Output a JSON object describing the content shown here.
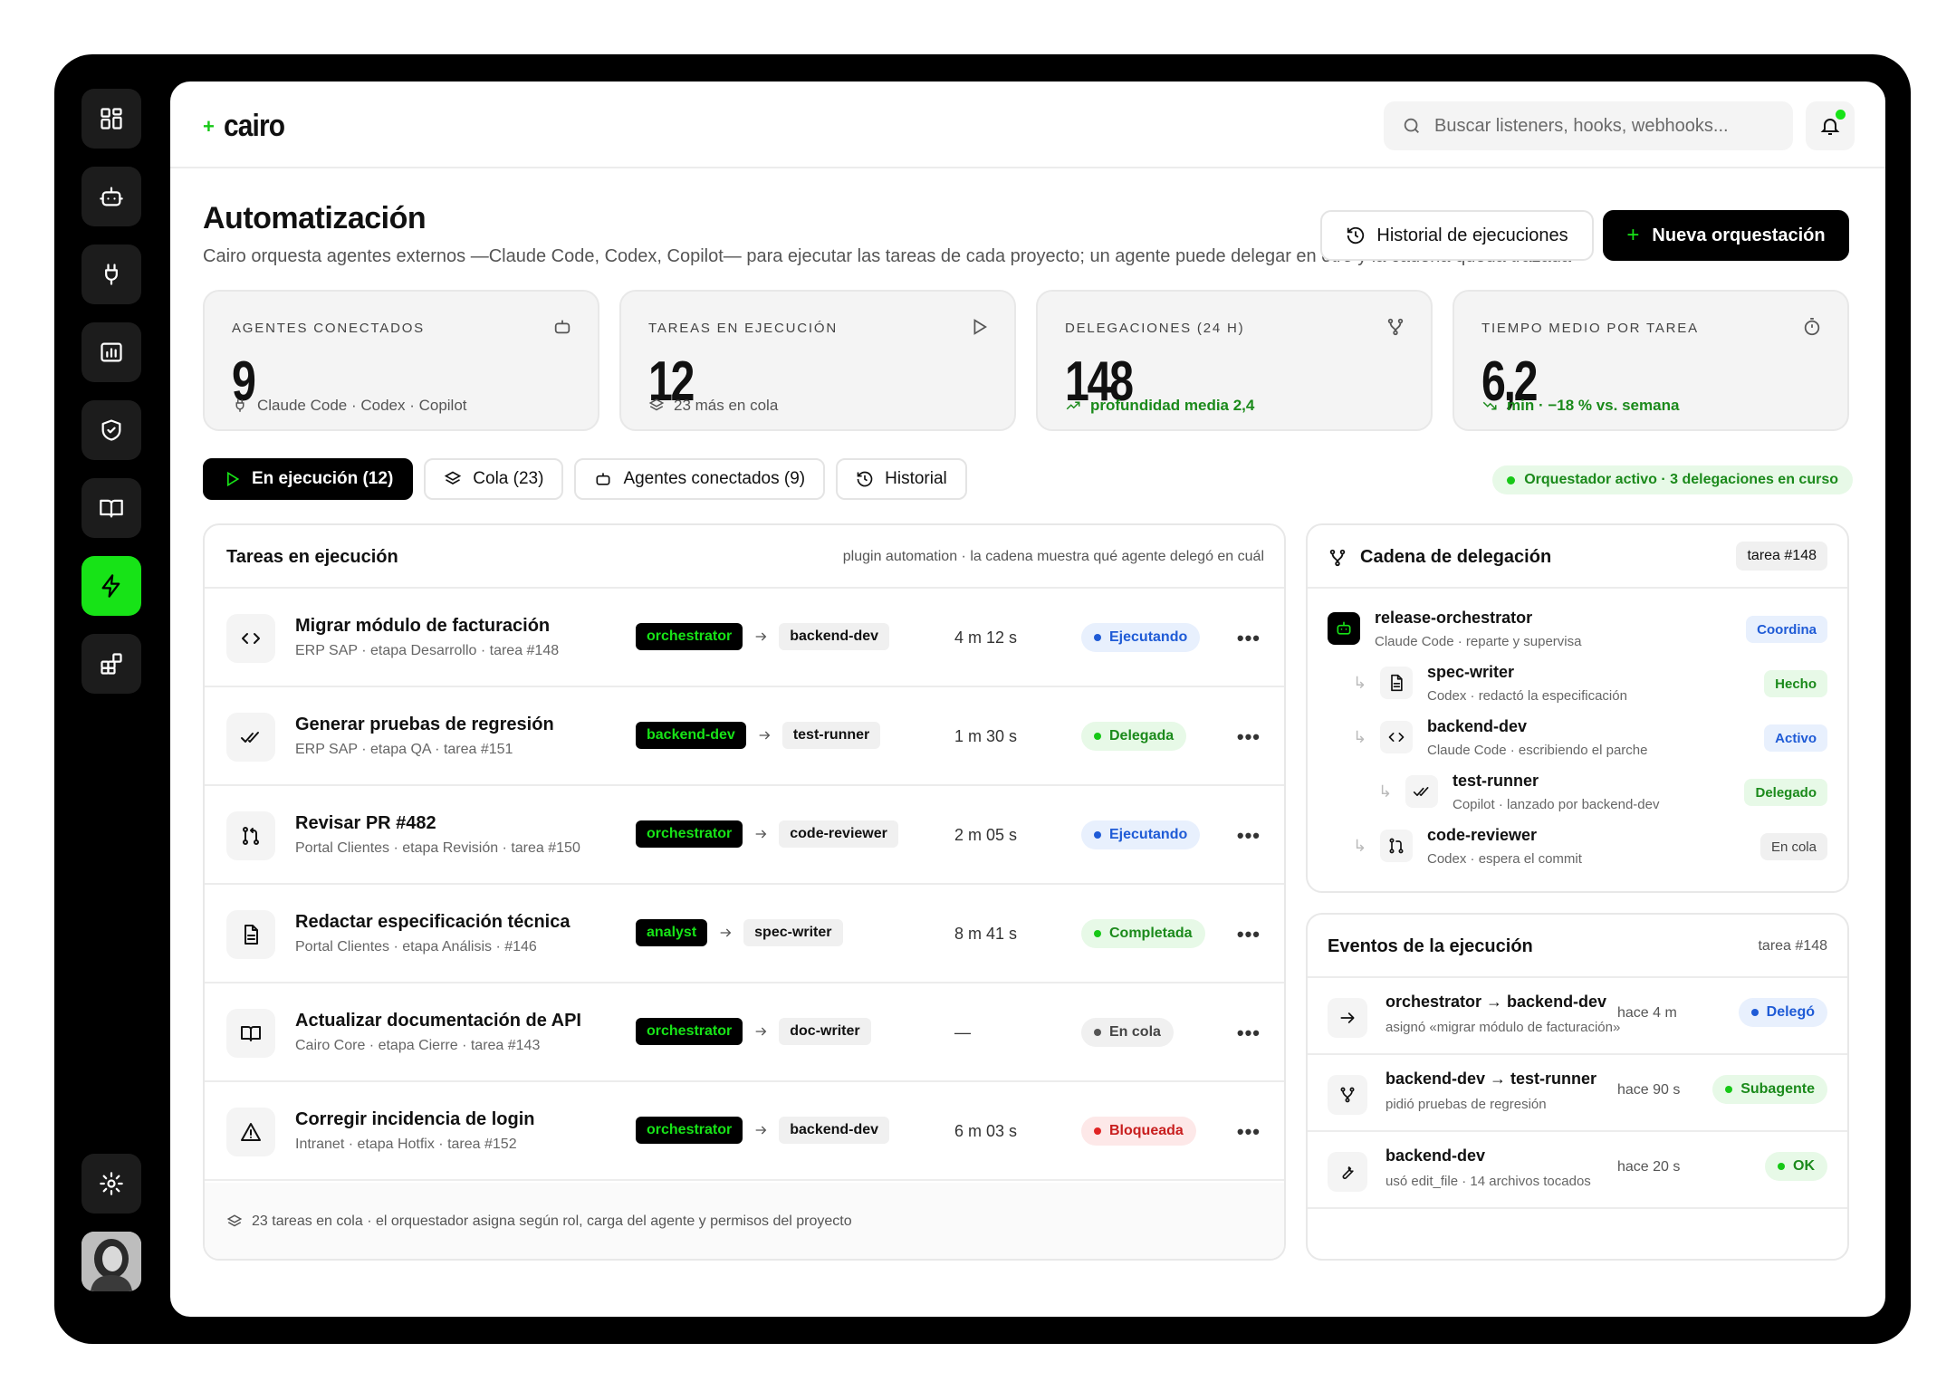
{
  "app": {
    "name": "cairo"
  },
  "search": {
    "placeholder": "Buscar listeners, hooks, webhooks..."
  },
  "page": {
    "title": "Automatización",
    "subtitle": "Cairo orquesta agentes externos —Claude Code, Codex, Copilot— para ejecutar las tareas de cada proyecto; un agente puede delegar en otro y la cadena queda trazada",
    "history_button": "Historial de ejecuciones",
    "new_button": "Nueva orquestación"
  },
  "kpis": [
    {
      "label": "AGENTES CONECTADOS",
      "value": "9",
      "footer": "Claude Code · Codex · Copilot"
    },
    {
      "label": "TAREAS EN EJECUCIÓN",
      "value": "12",
      "footer": "23 más en cola"
    },
    {
      "label": "DELEGACIONES (24 H)",
      "value": "148",
      "footer": "profundidad media 2,4"
    },
    {
      "label": "TIEMPO MEDIO POR TAREA",
      "value": "6,2",
      "footer": "min · −18 % vs. semana"
    }
  ],
  "tabs": [
    {
      "label": "En ejecución (12)"
    },
    {
      "label": "Cola (23)"
    },
    {
      "label": "Agentes conectados (9)"
    },
    {
      "label": "Historial"
    }
  ],
  "orchestrator_status": "Orquestador activo · 3 delegaciones en curso",
  "tasks": {
    "title": "Tareas en ejecución",
    "note": "plugin automation · la cadena muestra qué agente delegó en cuál",
    "rows": [
      {
        "name": "Migrar módulo de facturación",
        "meta": "ERP SAP · etapa Desarrollo · tarea #148",
        "from": "orchestrator",
        "to": "backend-dev",
        "time": "4 m 12 s",
        "status": "Ejecutando"
      },
      {
        "name": "Generar pruebas de regresión",
        "meta": "ERP SAP · etapa QA · tarea #151",
        "from": "backend-dev",
        "to": "test-runner",
        "time": "1 m 30 s",
        "status": "Delegada"
      },
      {
        "name": "Revisar PR #482",
        "meta": "Portal Clientes · etapa Revisión · tarea #150",
        "from": "orchestrator",
        "to": "code-reviewer",
        "time": "2 m 05 s",
        "status": "Ejecutando"
      },
      {
        "name": "Redactar especificación técnica",
        "meta": "Portal Clientes · etapa Análisis · #146",
        "from": "analyst",
        "to": "spec-writer",
        "time": "8 m 41 s",
        "status": "Completada"
      },
      {
        "name": "Actualizar documentación de API",
        "meta": "Cairo Core · etapa Cierre · tarea #143",
        "from": "orchestrator",
        "to": "doc-writer",
        "time": "—",
        "status": "En cola"
      },
      {
        "name": "Corregir incidencia de login",
        "meta": "Intranet · etapa Hotfix · tarea #152",
        "from": "orchestrator",
        "to": "backend-dev",
        "time": "6 m 03 s",
        "status": "Bloqueada"
      }
    ],
    "footer": "23 tareas en cola · el orquestador asigna según rol, carga del agente y permisos del proyecto",
    "more": "•••"
  },
  "chain": {
    "title": "Cadena de delegación",
    "task": "tarea #148",
    "nodes": [
      {
        "name": "release-orchestrator",
        "desc": "Claude Code · reparte y supervisa",
        "status": "Coordina"
      },
      {
        "name": "spec-writer",
        "desc": "Codex · redactó la especificación",
        "status": "Hecho"
      },
      {
        "name": "backend-dev",
        "desc": "Claude Code · escribiendo el parche",
        "status": "Activo"
      },
      {
        "name": "test-runner",
        "desc": "Copilot · lanzado por backend-dev",
        "status": "Delegado"
      },
      {
        "name": "code-reviewer",
        "desc": "Codex · espera el commit",
        "status": "En cola"
      }
    ]
  },
  "events": {
    "title": "Eventos de la ejecución",
    "task": "tarea #148",
    "items": [
      {
        "title": "orchestrator → backend-dev",
        "desc": "asignó «migrar módulo de facturación»",
        "when": "hace 4 m",
        "status": "Delegó"
      },
      {
        "title": "backend-dev → test-runner",
        "desc": "pidió pruebas de regresión",
        "when": "hace 90 s",
        "status": "Subagente"
      },
      {
        "title": "backend-dev",
        "desc": "usó edit_file · 14 archivos tocados",
        "when": "hace 20 s",
        "status": "OK"
      }
    ]
  },
  "colors": {
    "accent": "#17e317",
    "dark": "#000000",
    "blue": "#1f5bd6",
    "green": "#1b8a1b",
    "red": "#c81e1e"
  }
}
